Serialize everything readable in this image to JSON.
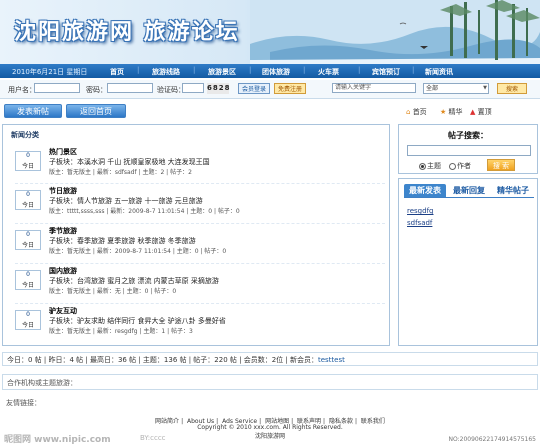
{
  "banner": {
    "title": "沈阳旅游网 旅游论坛"
  },
  "nav": {
    "date": "2010年6月21日 星期日",
    "items": [
      "首页",
      "旅游线路",
      "旅游景区",
      "团体旅游",
      "火车票",
      "宾馆预订",
      "新闻资讯"
    ]
  },
  "login": {
    "username_label": "用户名：",
    "password_label": "密码：",
    "captcha_label": "验证码：",
    "captcha_value": "6828",
    "login_btn": "会员登录",
    "register_btn": "免费注册",
    "search_placeholder": "请输入关键字",
    "scope_select": "全部",
    "search_btn": "搜索"
  },
  "actions": {
    "new_post": "发表新帖",
    "back_home": "返回首页"
  },
  "quick_links": {
    "home": "首页",
    "digest": "精华",
    "top": "置顶"
  },
  "categories": {
    "title": "新闻分类",
    "items": [
      {
        "day_num": "0",
        "day_label": "今日",
        "name": "热门景区",
        "sub": "子板块：本溪水洞  千山  抚顺皇家极地  大连发现王国",
        "meta": "版主：暂无版主 | 最新：sdfsadf | 主题：2 | 帖子：2"
      },
      {
        "day_num": "0",
        "day_label": "今日",
        "name": "节日旅游",
        "sub": "子板块：情人节旅游  五一旅游  十一旅游  元旦旅游",
        "meta": "版主：ttttt,ssss,sss | 最新：2009-8-7 11:01:54 | 主题：0 | 帖子：0"
      },
      {
        "day_num": "0",
        "day_label": "今日",
        "name": "季节旅游",
        "sub": "子板块：春季旅游  夏季旅游  秋季旅游  冬季旅游",
        "meta": "版主：暂无版主 | 最新：2009-8-7 11:01:54 | 主题：0 | 帖子：0"
      },
      {
        "day_num": "0",
        "day_label": "今日",
        "name": "国内旅游",
        "sub": "子板块：台湾旅游  蜜月之旅  漂流  内蒙古草原  采摘旅游",
        "meta": "版主：暂无版主 | 最新：无 | 主题：0 | 帖子：0"
      },
      {
        "day_num": "0",
        "day_label": "今日",
        "name": "驴友互动",
        "sub": "子板块：驴友求助  结伴同行  食昇大全  驴途八卦  多曼好省",
        "meta": "版主：暂无版主 | 最新：resgdfg | 主题：1 | 帖子：3"
      }
    ]
  },
  "side_search": {
    "title": "帖子搜索：",
    "opt_subject": "主题",
    "opt_author": "作者",
    "btn": "搜 索"
  },
  "side_tabs": {
    "tabs": [
      "最新发表",
      "最新回复",
      "精华帖子"
    ],
    "links": [
      "resgdfg",
      "sdfsadf"
    ]
  },
  "stats": "今日：0 帖 | 昨日：4 帖 | 最高日：36 帖 | 主题：136 帖 | 帖子：220 帖 | 会员数：2位 | 新会员：",
  "stats_new_member": "testtest",
  "partners_label": "合作机构或主题旅游：",
  "friend_links_label": "友情链接：",
  "footer": {
    "links": [
      "网站简介",
      "About Us",
      "Ads Service",
      "网站地图",
      "联系声明",
      "隐私条款",
      "联系我们"
    ],
    "copyright": "Copyright © 2010 xxx.com. All Rights Reserved.",
    "site": "沈阳旅游网"
  },
  "watermark": {
    "left": "昵图网 www.nipic.com",
    "middle": "BY:cccc",
    "id": "NO:20090622174914575165"
  }
}
